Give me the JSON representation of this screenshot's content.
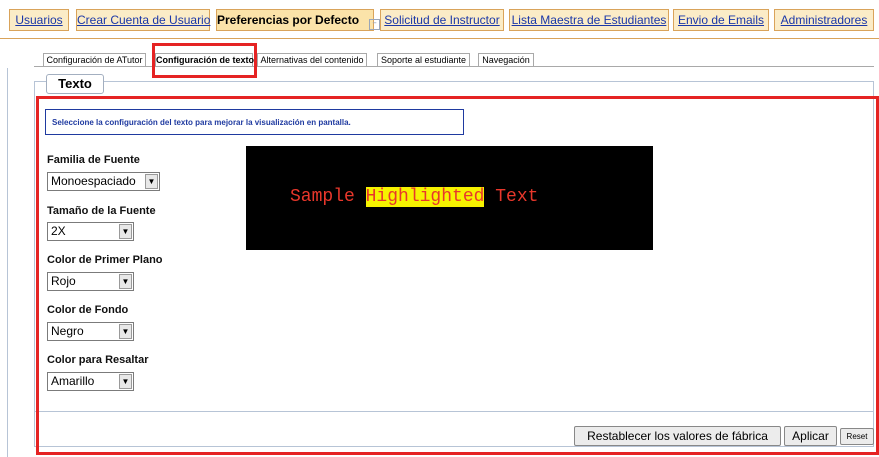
{
  "top_tabs": [
    {
      "label": "Usuarios"
    },
    {
      "label": "Crear Cuenta de Usuario"
    },
    {
      "label": "Preferencias por Defecto",
      "active": true,
      "icon": "minimize-icon"
    },
    {
      "label": "Solicitud de Instructor"
    },
    {
      "label": "Lista Maestra de Estudiantes"
    },
    {
      "label": "Envio de Emails"
    },
    {
      "label": "Administradores"
    }
  ],
  "sub_tabs": [
    {
      "label": "Configuración de ATutor"
    },
    {
      "label": "Configuración de texto",
      "active": true
    },
    {
      "label": "Alternativas del contenido"
    },
    {
      "label": "Soporte al estudiante"
    },
    {
      "label": "Navegación"
    }
  ],
  "section_title": "Texto",
  "instruction": "Seleccione la configuración del texto para mejorar la visualización en pantalla.",
  "fields": {
    "font_family": {
      "label": "Familia de Fuente",
      "value": "Monoespaciado"
    },
    "font_size": {
      "label": "Tamaño de la Fuente",
      "value": "2X"
    },
    "foreground": {
      "label": "Color de Primer Plano",
      "value": "Rojo"
    },
    "background": {
      "label": "Color de Fondo",
      "value": "Negro"
    },
    "highlight": {
      "label": "Color para Resaltar",
      "value": "Amarillo"
    }
  },
  "preview": {
    "before": "Sample ",
    "highlighted": "Highlighted",
    "after": " Text",
    "bg_color": "#000000",
    "fg_color": "#e8372b",
    "highlight_color": "#f6f200"
  },
  "buttons": {
    "restore": "Restablecer los valores de fábrica",
    "apply": "Aplicar",
    "reset": "Reset"
  }
}
